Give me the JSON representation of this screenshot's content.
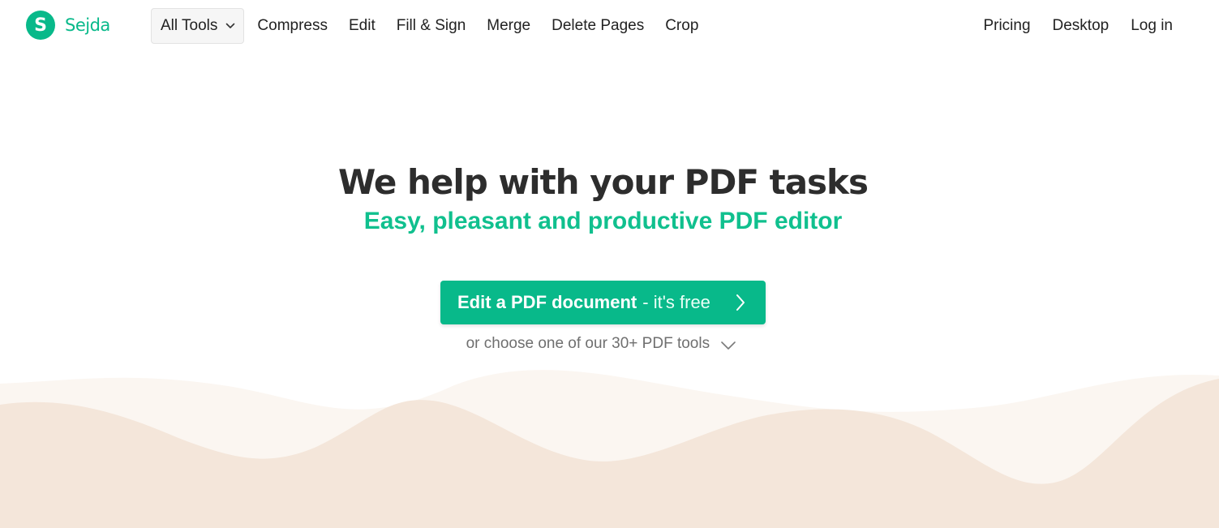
{
  "brand": {
    "logo_letter": "S",
    "name": "Sejda",
    "color": "#08b98a"
  },
  "nav": {
    "dropdown_label": "All Tools",
    "links": [
      "Compress",
      "Edit",
      "Fill & Sign",
      "Merge",
      "Delete Pages",
      "Crop"
    ],
    "right_links": [
      "Pricing",
      "Desktop",
      "Log in"
    ]
  },
  "hero": {
    "title": "We help with your PDF tasks",
    "subtitle": "Easy, pleasant and productive PDF editor",
    "subtitle_color": "#10c08e"
  },
  "cta": {
    "strong": "Edit a PDF document",
    "light": "- it's free",
    "icon": "chevron-right-icon",
    "color": "#08b98a"
  },
  "tools_link": {
    "text": "or choose one of our 30+ PDF tools",
    "icon": "chevron-down-icon"
  },
  "waves": {
    "back_color": "#fbf6f1",
    "front_color": "#f4e6da"
  }
}
